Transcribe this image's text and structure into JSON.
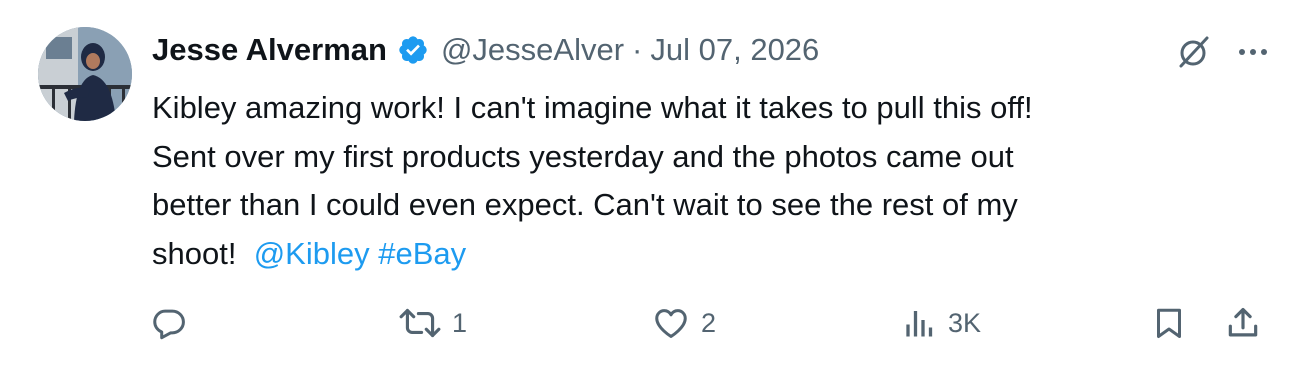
{
  "tweet": {
    "author_name": "Jesse Alverman",
    "handle": "@JesseAlver",
    "separator": "·",
    "date": "Jul 07, 2026",
    "text_lines": [
      "Kibley amazing work! I can't imagine what it takes to pull this off!",
      "Sent over my first products yesterday and the photos came out",
      "better than I could even expect. Can't wait to see the rest of my",
      "shoot!"
    ],
    "mention": "@Kibley",
    "hashtag": "#eBay"
  },
  "actions": {
    "reply_count": "",
    "retweet_count": "1",
    "like_count": "2",
    "views_count": "3K"
  },
  "icons": {
    "verified": "verified-badge-icon",
    "grok": "grok-icon",
    "more": "more-icon",
    "reply": "reply-icon",
    "retweet": "retweet-icon",
    "like": "heart-icon",
    "views": "views-icon",
    "bookmark": "bookmark-icon",
    "share": "share-icon"
  },
  "colors": {
    "link": "#1d9bf0",
    "muted": "#536471",
    "text": "#0f1419",
    "verified": "#1d9bf0"
  }
}
